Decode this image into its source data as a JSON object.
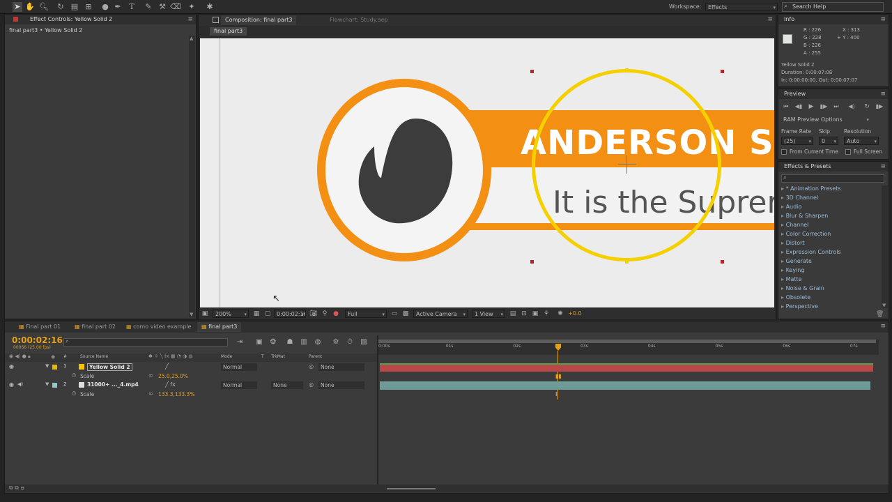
{
  "toolbar": {
    "workspace_label": "Workspace:",
    "workspace_value": "Effects",
    "search_placeholder": "Search Help"
  },
  "effect_controls": {
    "tab_label": "Effect Controls: Yellow Solid 2",
    "breadcrumb": "final part3 • Yellow Solid 2"
  },
  "composition": {
    "tab_label": "Composition: final part3",
    "flowchart_tab": "Flowchart: Study.aep",
    "comp_button": "final part3",
    "zoom": "200%",
    "timecode": "0:00:02:16",
    "resolution": "Full",
    "camera": "Active Camera",
    "views": "1 View",
    "exposure": "+0.0",
    "lower_third": {
      "title": "ANDERSON S",
      "subtitle": "It is the Suprer"
    }
  },
  "info": {
    "tab_label": "Info",
    "r": "R : 226",
    "g": "G : 228",
    "b": "B : 226",
    "a": "A : 255",
    "x": "X : 313",
    "y": "+ Y : 400",
    "layer": "Yellow Solid 2",
    "duration": "Duration: 0:00:07:08",
    "in_out": "In: 0:00:00:00, Out: 0:00:07:07",
    "swatch_color": "#e2e4e2"
  },
  "preview": {
    "tab_label": "Preview",
    "ram_options": "RAM Preview Options",
    "frame_rate_label": "Frame Rate",
    "skip_label": "Skip",
    "resolution_label": "Resolution",
    "frame_rate_value": "(25)",
    "skip_value": "0",
    "resolution_value": "Auto",
    "from_current": "From Current Time",
    "full_screen": "Full Screen"
  },
  "effects_presets": {
    "tab_label": "Effects & Presets",
    "items": [
      "* Animation Presets",
      "3D Channel",
      "Audio",
      "Blur & Sharpen",
      "Channel",
      "Color Correction",
      "Distort",
      "Expression Controls",
      "Generate",
      "Keying",
      "Matte",
      "Noise & Grain",
      "Obsolete",
      "Perspective"
    ]
  },
  "timeline": {
    "tabs": [
      "Final part 01",
      "final part 02",
      "como video example",
      "final part3"
    ],
    "timecode": "0:00:02:16",
    "frame_info": "00066 (25.00 fps)",
    "columns": {
      "num": "#",
      "source": "Source Name",
      "mode": "Mode",
      "t": "T",
      "trkmat": "TrkMat",
      "parent": "Parent"
    },
    "ruler": [
      "0:00s",
      "01s",
      "02s",
      "03s",
      "04s",
      "05s",
      "06s",
      "07s"
    ],
    "layers": [
      {
        "num": "1",
        "name": "Yellow Solid 2",
        "mode": "Normal",
        "trkmat": "",
        "parent": "None",
        "prop": "Scale",
        "value": "25.0,25.0%",
        "label_color": "#e7b800",
        "bar_color": "#b84848"
      },
      {
        "num": "2",
        "name": "31000+ ..._4.mp4",
        "mode": "Normal",
        "trkmat": "None",
        "parent": "None",
        "prop": "Scale",
        "value": "133.3,133.3%",
        "label_color": "#8fc7c7",
        "bar_color": "#6e9a98"
      }
    ]
  },
  "colors": {
    "accent_orange": "#f39014",
    "yellow_circle": "#f5d000",
    "timecode_color": "#e3a11a"
  }
}
